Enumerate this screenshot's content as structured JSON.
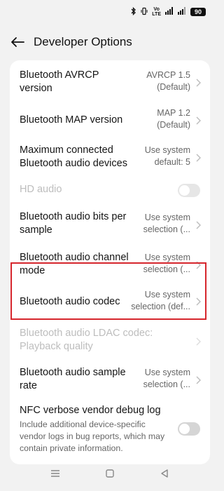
{
  "status_bar": {
    "bluetooth_icon": "bluetooth-icon",
    "vibrate_icon": "vibrate-icon",
    "lte_top": "Vo",
    "lte_bottom": "LTE",
    "signal_icon": "signal-icon",
    "battery": "90"
  },
  "header": {
    "back_icon": "arrow-left-icon",
    "title": "Developer Options"
  },
  "settings": [
    {
      "label": "Bluetooth AVRCP version",
      "value": "AVRCP 1.5 (Default)"
    },
    {
      "label": "Bluetooth MAP version",
      "value": "MAP 1.2 (Default)"
    },
    {
      "label": "Maximum connected Bluetooth audio devices",
      "value": "Use system default: 5"
    },
    {
      "label": "HD audio",
      "toggle": "off",
      "disabled": true
    },
    {
      "label": "Bluetooth audio bits per sample",
      "value": "Use system selection (..."
    },
    {
      "label": "Bluetooth audio channel mode",
      "value": "Use system selection (..."
    },
    {
      "label": "Bluetooth audio codec",
      "value": "Use system selection (def...",
      "highlighted": true
    },
    {
      "label": "Bluetooth audio LDAC codec: Playback quality",
      "disabled": true
    },
    {
      "label": "Bluetooth audio sample rate",
      "value": "Use system selection (..."
    },
    {
      "label": "NFC verbose vendor debug log",
      "description": "Include additional device-specific vendor logs in bug reports, which may contain private information.",
      "toggle": "off"
    }
  ],
  "text": {
    "avrcp_l1": "Bluetooth AVRCP",
    "avrcp_l2": "version",
    "avrcp_v1": "AVRCP 1.5",
    "avrcp_v2": "(Default)",
    "map_l1": "Bluetooth MAP version",
    "map_v1": "MAP 1.2",
    "map_v2": "(Default)",
    "max_l1": "Maximum connected",
    "max_l2": "Bluetooth audio devices",
    "max_v1": "Use system",
    "max_v2": "default: 5",
    "hd_l1": "HD audio",
    "bits_l1": "Bluetooth audio bits per",
    "bits_l2": "sample",
    "bits_v1": "Use system",
    "bits_v2": "selection (...",
    "chan_l1": "Bluetooth audio channel",
    "chan_l2": "mode",
    "chan_v1": "Use system",
    "chan_v2": "selection (...",
    "codec_l1": "Bluetooth audio codec",
    "codec_v1": "Use system",
    "codec_v2": "selection (def...",
    "ldac_l1": "Bluetooth audio LDAC codec:",
    "ldac_l2": "Playback quality",
    "rate_l1": "Bluetooth audio sample",
    "rate_l2": "rate",
    "rate_v1": "Use system",
    "rate_v2": "selection (...",
    "nfc_l1": "NFC verbose vendor debug log",
    "nfc_d1": "Include additional device-specific",
    "nfc_d2": "vendor logs in bug reports, which may",
    "nfc_d3": "contain private information."
  },
  "nav": {
    "recents_icon": "menu-lines-icon",
    "home_icon": "square-home-icon",
    "back_icon": "triangle-back-icon"
  },
  "colors": {
    "background": "#f2f2f2",
    "card": "#ffffff",
    "highlight_border": "#d6262d",
    "secondary_text": "#666666",
    "disabled_text": "#bdbdbd"
  }
}
